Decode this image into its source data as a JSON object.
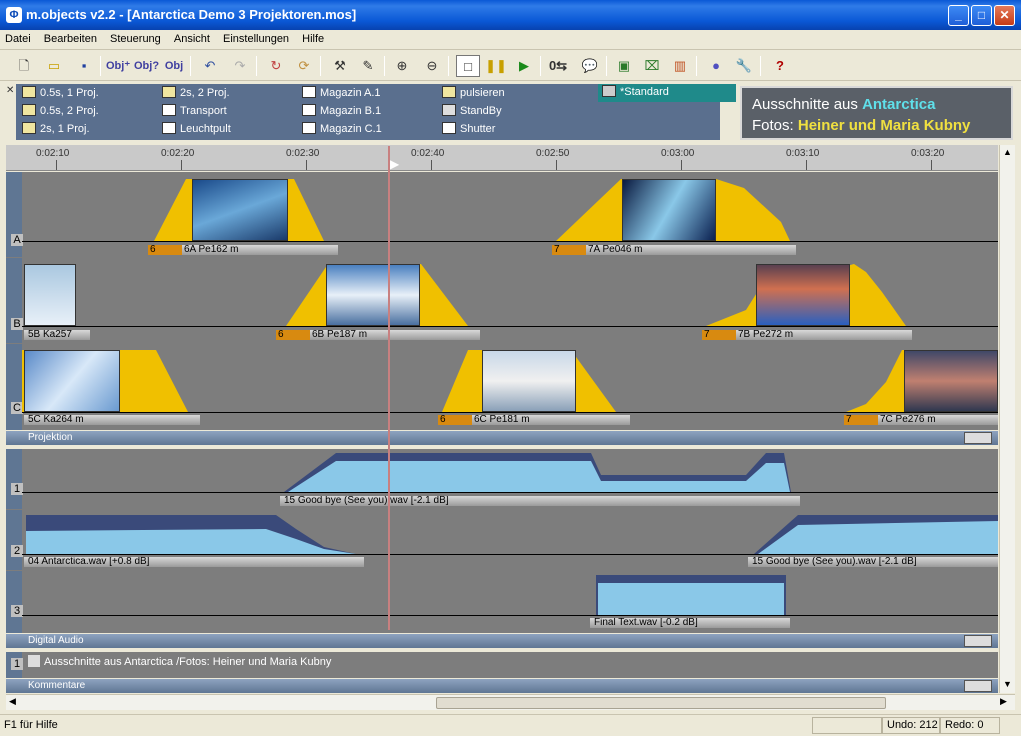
{
  "window": {
    "title": "m.objects v2.2 - [Antarctica Demo 3 Projektoren.mos]",
    "icon": "app-logo-icon"
  },
  "menu": [
    "Datei",
    "Bearbeiten",
    "Steuerung",
    "Ansicht",
    "Einstellungen",
    "Hilfe"
  ],
  "toolbar_icons": [
    "new-icon",
    "open-icon",
    "save-icon",
    "obj-add-icon",
    "obj-help-icon",
    "obj-icon",
    "undo-icon",
    "redo-icon",
    "refresh-icon",
    "sync-icon",
    "hammer-icon",
    "pin-icon",
    "zoom-in-icon",
    "zoom-out-icon",
    "stop-icon",
    "pause-icon",
    "play-icon",
    "zero-jump-icon",
    "speech-icon",
    "image-icon",
    "projector-icon",
    "bars-icon",
    "color-icon",
    "wrench-icon",
    "help-icon"
  ],
  "tools": {
    "col1": [
      "0.5s, 1 Proj.",
      "0.5s, 2 Proj.",
      "2s, 1 Proj."
    ],
    "col2": [
      "2s, 2 Proj.",
      "Transport",
      "Leuchtpult"
    ],
    "col3": [
      "Magazin A.1",
      "Magazin B.1",
      "Magazin C.1"
    ],
    "col4": [
      "pulsieren",
      "StandBy",
      "Shutter"
    ],
    "col5": [
      "*Standard"
    ]
  },
  "comment_preview": {
    "line1_a": "Ausschnitte aus ",
    "line1_b": "Antarctica",
    "line2_a": "Fotos: ",
    "line2_b": "Heiner und Maria Kubny",
    "accent": "#5fe0ea",
    "highlight": "#f0e040"
  },
  "ruler": [
    "0:02:10",
    "0:02:20",
    "0:02:30",
    "0:02:40",
    "0:02:50",
    "0:03:00",
    "0:03:10",
    "0:03:20"
  ],
  "projection": {
    "lanes": [
      "A",
      "B",
      "C"
    ],
    "clips": [
      {
        "num": "6",
        "label": "6A Pe162 m"
      },
      {
        "num": "7",
        "label": "7A Pe046 m"
      },
      {
        "num": "",
        "label": "5B Ka257"
      },
      {
        "num": "6",
        "label": "6B Pe187 m"
      },
      {
        "num": "7",
        "label": "7B Pe272 m"
      },
      {
        "num": "",
        "label": "5C Ka264 m"
      },
      {
        "num": "6",
        "label": "6C Pe181 m"
      },
      {
        "num": "7",
        "label": "7C Pe276 m"
      }
    ],
    "section": "Projektion"
  },
  "audio": {
    "lanes": [
      "1",
      "2",
      "3"
    ],
    "clips": [
      "15 Good bye (See you).wav [-2.1 dB]",
      "04 Antarctica.wav [+0.8 dB]",
      "15 Good bye (See you).wav [-2.1 dB]",
      "Final Text.wav [-0.2 dB]"
    ],
    "section": "Digital Audio"
  },
  "comments": {
    "lane": "1",
    "text": "Ausschnitte aus Antarctica /Fotos: Heiner und Maria Kubny",
    "section": "Kommentare"
  },
  "status": {
    "help": "F1 für Hilfe",
    "undo": "Undo: 212",
    "redo": "Redo: 0"
  }
}
